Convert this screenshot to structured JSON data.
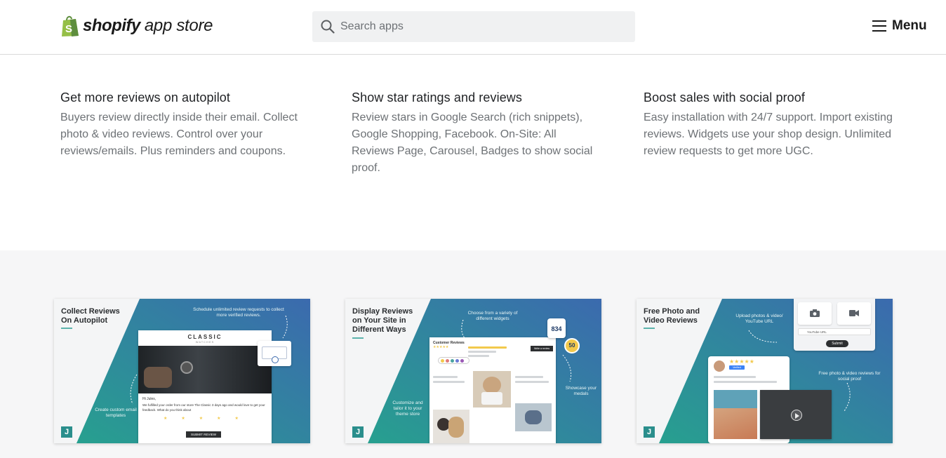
{
  "header": {
    "logo_word": "shopify",
    "logo_sub": "app store",
    "search_placeholder": "Search apps",
    "menu_label": "Menu"
  },
  "features": [
    {
      "title": "Get more reviews on autopilot",
      "text": "Buyers review directly inside their email. Collect photo & video reviews. Control over your reviews/emails. Plus reminders and coupons."
    },
    {
      "title": "Show star ratings and reviews",
      "text": "Review stars in Google Search (rich snippets), Google Shopping, Facebook. On-Site: All Reviews Page, Carousel, Badges to show social proof."
    },
    {
      "title": "Boost sales with social proof",
      "text": "Easy installation with 24/7 support. Import existing reviews. Widgets use your shop design. Unlimited review requests to get more UGC."
    }
  ],
  "screenshots": [
    {
      "title": "Collect Reviews On Autopilot",
      "note_top": "Schedule unlimited review requests to collect more verified reviews.",
      "note_left": "Create custom email templates",
      "brand": "CLASSIC",
      "brand_sub": "WATCHES",
      "greeting": "Hi Jules,",
      "body": "We fulfilled your order from our store The Classic 3 days ago and would love to get your feedback. What do you think about",
      "product": "Watch",
      "button": "SUBMIT REVIEW",
      "badge": "J"
    },
    {
      "title": "Display Reviews on Your Site in Different Ways",
      "note_top": "Choose from a variety of different widgets",
      "note_left": "Customize and tailor it to your theme store",
      "note_right": "Showcase your medals",
      "widget_title": "Customer Reviews",
      "write_review": "Write a review",
      "medal_1": "834",
      "medal_2": "50",
      "badge": "J"
    },
    {
      "title": "Free Photo and Video Reviews",
      "note_top": "Upload photos & video/ YouTube URL",
      "note_right": "Free photo & video reviews for social proof",
      "youtube_placeholder": "YouTube URL",
      "submit": "Submit",
      "verified": "Verified",
      "badge": "J"
    }
  ],
  "colors": {
    "teal": "#2a9d93",
    "blue": "#3b6fb0",
    "band": "#f6f6f7",
    "text_muted": "#6d7175",
    "shopify_green": "#95bf47"
  }
}
